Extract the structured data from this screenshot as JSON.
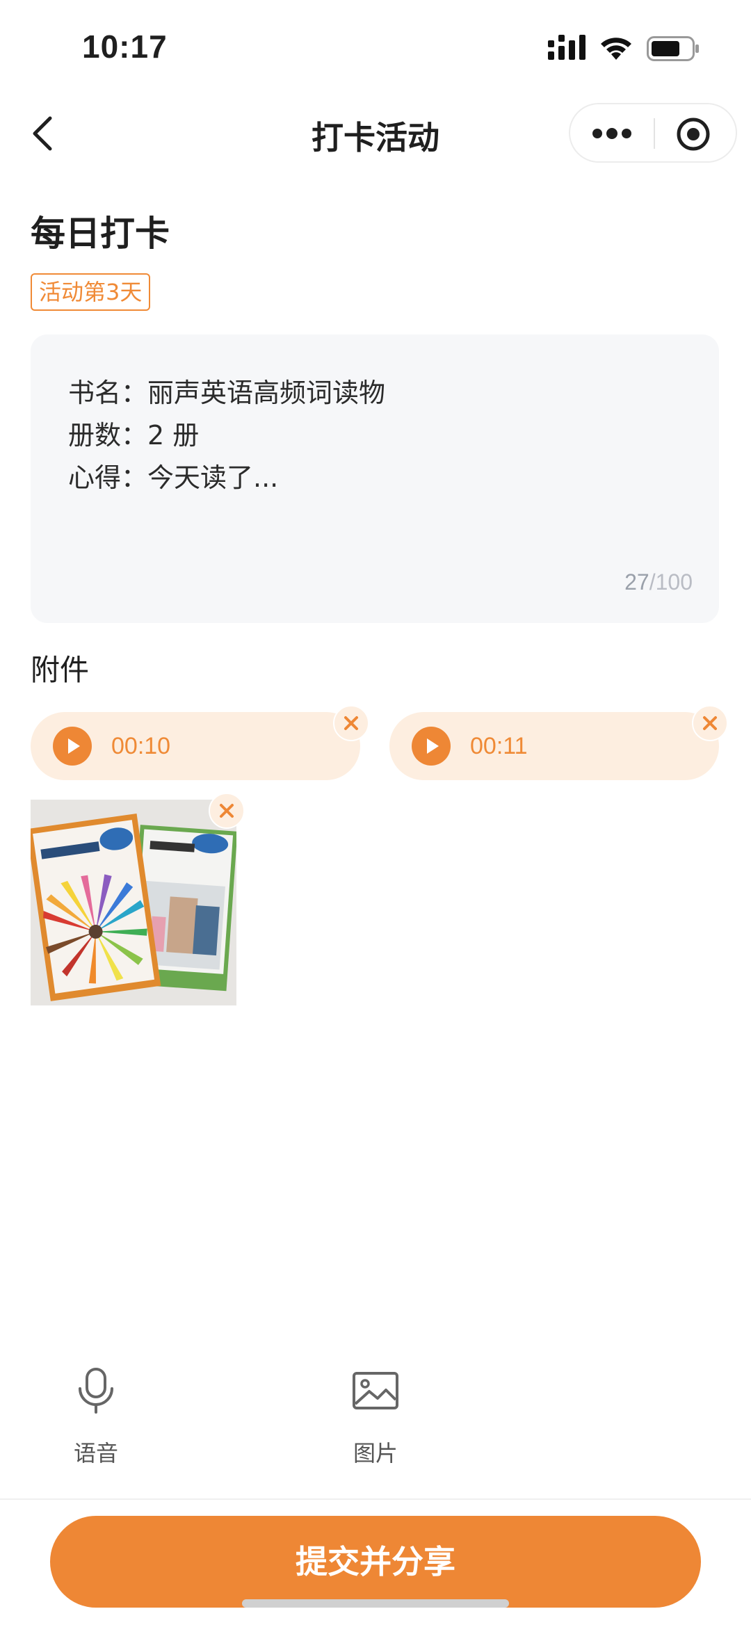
{
  "status_bar": {
    "time": "10:17"
  },
  "nav": {
    "title": "打卡活动"
  },
  "activity": {
    "title": "每日打卡",
    "day_tag": "活动第3天"
  },
  "entry": {
    "lines": [
      {
        "label": "书名：",
        "value": "丽声英语高频词读物"
      },
      {
        "label": "册数：",
        "value": "2 册"
      },
      {
        "label": "心得：",
        "value": "今天读了..."
      }
    ],
    "char_count": "27",
    "char_limit": "/100"
  },
  "attachments": {
    "label": "附件",
    "voices": [
      {
        "duration": "00:10"
      },
      {
        "duration": "00:11"
      }
    ]
  },
  "toolbar": {
    "voice_label": "语音",
    "image_label": "图片"
  },
  "submit": {
    "label": "提交并分享"
  },
  "colors": {
    "accent": "#EE8735",
    "chip_bg": "#FDEEE0",
    "input_bg": "#F6F7F9"
  }
}
